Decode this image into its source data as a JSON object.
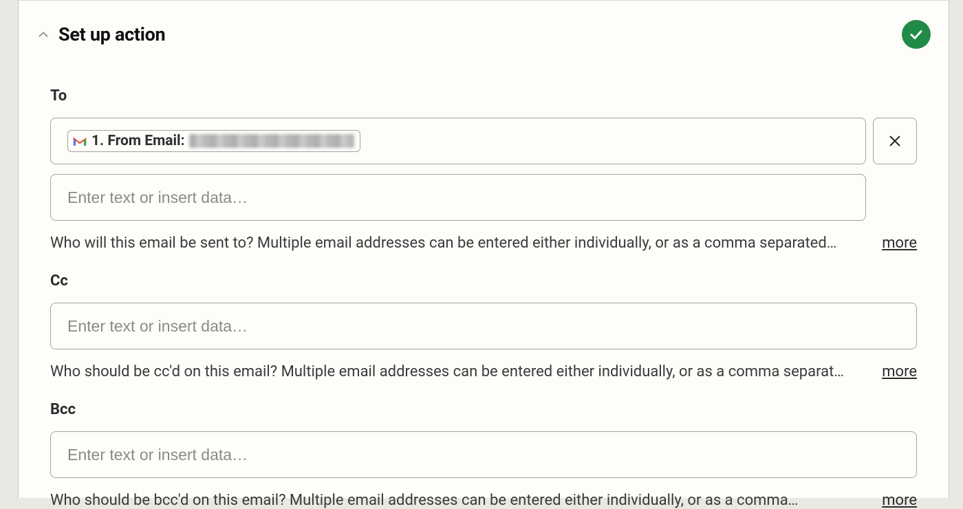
{
  "section": {
    "title": "Set up action",
    "completed": true
  },
  "fields": {
    "to": {
      "label": "To",
      "pill": {
        "icon": "gmail-icon",
        "prefix": "1. From Email:",
        "value_redacted": true
      },
      "input_placeholder": "Enter text or insert data…",
      "helper": "Who will this email be sent to? Multiple email addresses can be entered either individually, or as a comma separated…",
      "more": "more"
    },
    "cc": {
      "label": "Cc",
      "input_placeholder": "Enter text or insert data…",
      "helper": "Who should be cc'd on this email? Multiple email addresses can be entered either individually, or as a comma separat…",
      "more": "more"
    },
    "bcc": {
      "label": "Bcc",
      "input_placeholder": "Enter text or insert data…",
      "helper": "Who should be bcc'd on this email? Multiple email addresses can be entered either individually, or as a comma…",
      "more": "more"
    }
  }
}
